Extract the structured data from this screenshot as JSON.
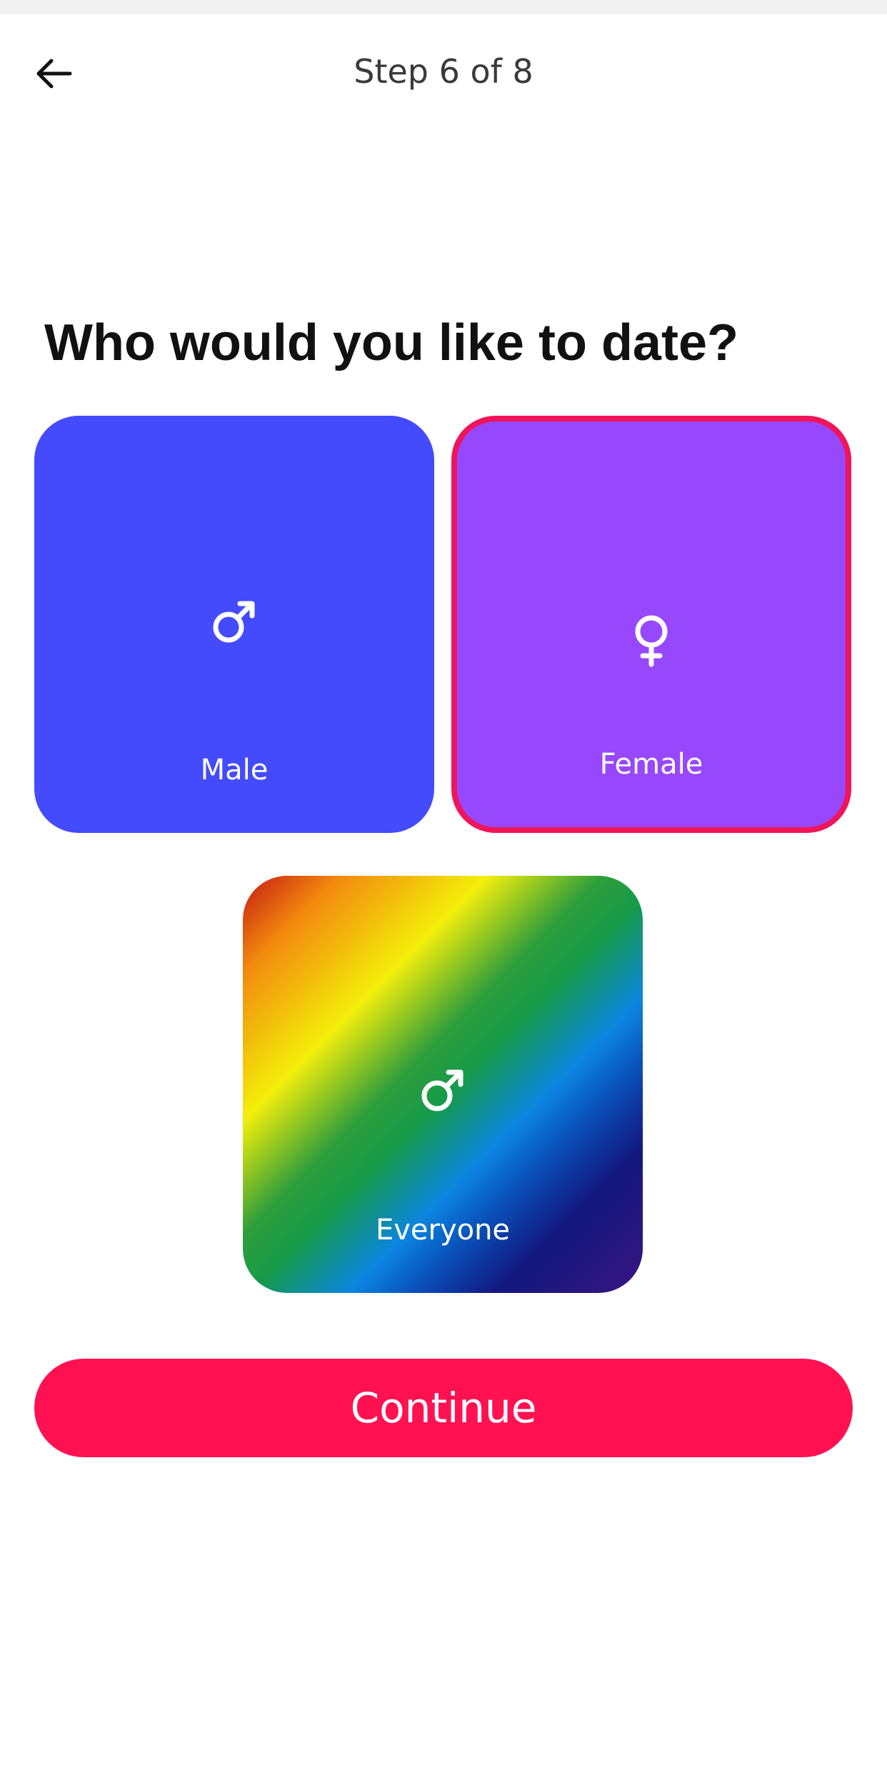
{
  "header": {
    "step_text": "Step 6 of 8",
    "back_icon": "arrow-left-icon"
  },
  "question": {
    "title": "Who would you like to date?"
  },
  "options": [
    {
      "label": "Male",
      "icon": "male-symbol-icon",
      "color": "#434bfd",
      "selected": false
    },
    {
      "label": "Female",
      "icon": "female-symbol-icon",
      "color": "#9748fd",
      "selected": true,
      "selected_border_color": "#f0145a"
    },
    {
      "label": "Everyone",
      "icon": "male-symbol-icon",
      "color": "rainbow-gradient",
      "selected": false
    }
  ],
  "actions": {
    "continue_label": "Continue",
    "continue_color": "#ff1152"
  }
}
